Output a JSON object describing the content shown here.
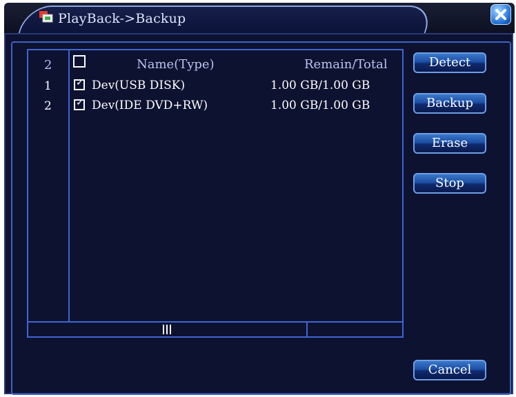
{
  "window": {
    "title": "PlayBack->Backup"
  },
  "table": {
    "header": {
      "count": "2",
      "name_type": "Name(Type)",
      "remain_total": "Remain/Total"
    },
    "rows": [
      {
        "index": "1",
        "name": "Dev(USB DISK)",
        "capacity": "1.00 GB/1.00 GB",
        "checked": true
      },
      {
        "index": "2",
        "name": "Dev(IDE DVD+RW)",
        "capacity": "1.00 GB/1.00 GB",
        "checked": true
      }
    ]
  },
  "buttons": {
    "detect": "Detect",
    "backup": "Backup",
    "erase": "Erase",
    "stop": "Stop",
    "cancel": "Cancel"
  }
}
